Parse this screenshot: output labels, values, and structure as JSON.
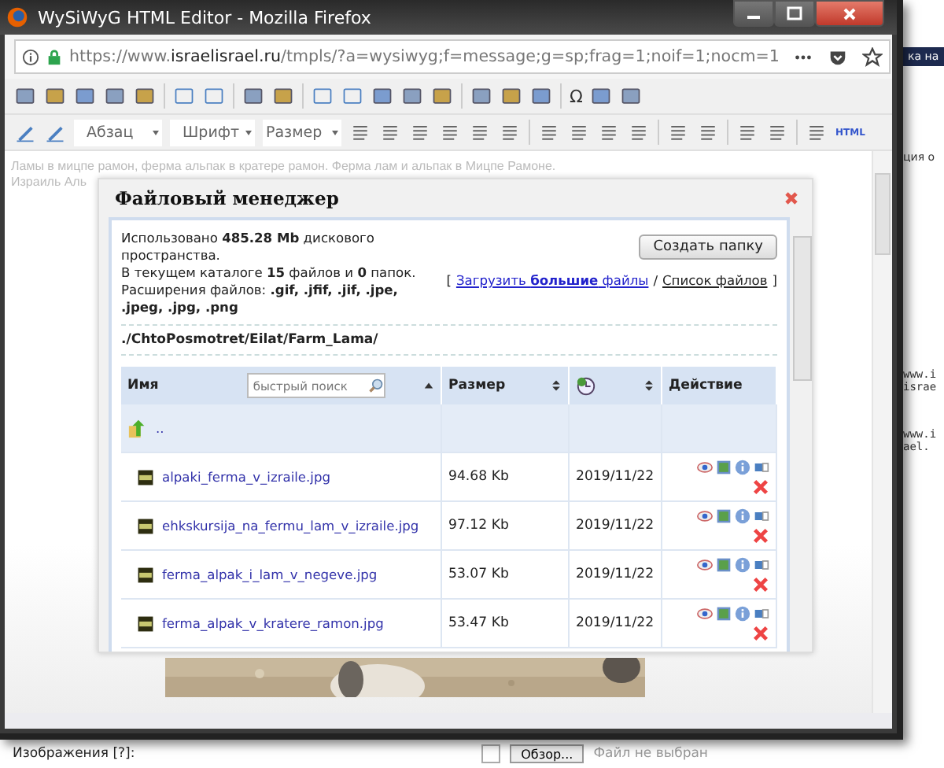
{
  "window": {
    "title": "WySiWyG HTML Editor - Mozilla Firefox"
  },
  "address_bar": {
    "url_prefix": "https://www.",
    "url_domain": "israelisrael.ru",
    "url_rest": "/tmpls/?a=wysiwyg;f=message;g=sp;frag=1;noif=1;nocm=1"
  },
  "format_toolbar": {
    "dropdowns": [
      "Абзац",
      "Шрифт",
      "Размер"
    ],
    "special_char": "Ω",
    "html_badge": "HTML"
  },
  "editor": {
    "lines": [
      "Ламы в мицпе рамон, ферма альпак в кратере рамон. Ферма лам и альпак в Мицпе Рамоне.",
      "Израиль Аль"
    ]
  },
  "dialog": {
    "title": "Файловый менеджер",
    "info": "Использовано **485.28 Mb** дискового пространства.",
    "info2": "В текущем каталоге **15** файлов и **0** папок.",
    "info3": "Расширения файлов: **.gif, .jfif, .jif, .jpe, .jpeg, .jpg, .png**",
    "create_button": "Создать папку",
    "links": {
      "open": "[",
      "upload": "Загрузить **большие** файлы",
      "sep": "/",
      "list": "Список файлов",
      "close": "]"
    },
    "path": "./ChtoPosmotret/Eilat/Farm_Lama/",
    "columns": {
      "name": "Имя",
      "search_placeholder": "быстрый поиск",
      "size": "Размер",
      "action": "Действие"
    },
    "up_row": "..",
    "rows": [
      {
        "name": "alpaki_ferma_v_izraile.jpg",
        "size": "94.68 Kb",
        "date": "2019/11/22"
      },
      {
        "name": "ehkskursija_na_fermu_lam_v_izraile.jpg",
        "size": "97.12 Kb",
        "date": "2019/11/22"
      },
      {
        "name": "ferma_alpak_i_lam_v_negeve.jpg",
        "size": "53.07 Kb",
        "date": "2019/11/22"
      },
      {
        "name": "ferma_alpak_v_kratere_ramon.jpg",
        "size": "53.47 Kb",
        "date": "2019/11/22"
      }
    ]
  },
  "background_page": {
    "fragments": [
      "ка на",
      "ция о",
      "www.i",
      "israe",
      "www.i",
      "ael."
    ],
    "images_label": "Изображения [?]:",
    "browse_button": "Обзор...",
    "file_status": "Файл не выбран"
  }
}
